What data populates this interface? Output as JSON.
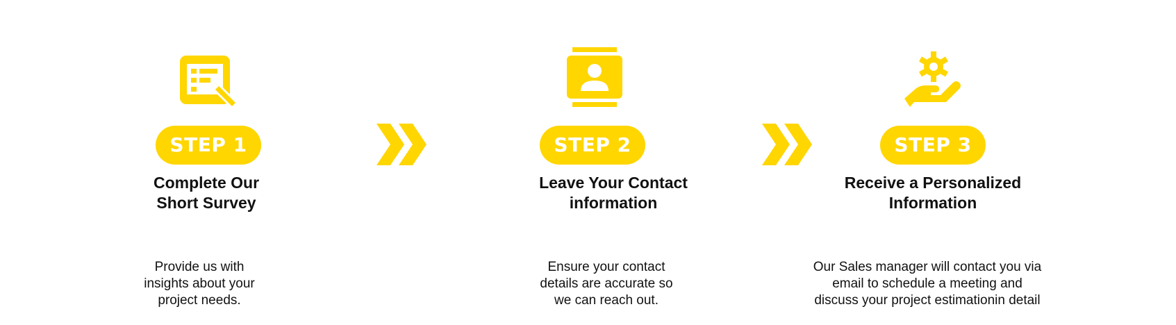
{
  "colors": {
    "accent": "#FFD600",
    "text": "#111111",
    "pill_text": "#FFFFFF",
    "background": "#FFFFFF"
  },
  "steps": [
    {
      "icon": "survey-form-icon",
      "label": "STEP 1",
      "title": "Complete Our\nShort Survey",
      "description": "Provide us with\ninsights about your\nproject needs."
    },
    {
      "icon": "contact-card-icon",
      "label": "STEP 2",
      "title": "Leave Your Contact\ninformation",
      "description": "Ensure your contact\ndetails are accurate so\nwe can reach out."
    },
    {
      "icon": "hand-gear-icon",
      "label": "STEP 3",
      "title": "Receive a Personalized\nInformation",
      "description": "Our Sales manager will contact you via\nemail to schedule a meeting and\ndiscuss your project estimationin detail"
    }
  ],
  "separators": [
    {
      "icon": "double-chevron-right-icon"
    },
    {
      "icon": "double-chevron-right-icon"
    }
  ]
}
